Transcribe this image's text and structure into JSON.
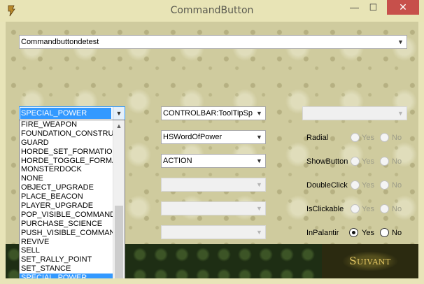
{
  "window": {
    "title": "CommandButton",
    "minimize": "—",
    "maximize": "☐",
    "close": "✕"
  },
  "top_combo": {
    "value": "Commandbuttondetest"
  },
  "command_type": {
    "value": "SPECIAL_POWER",
    "options": [
      "FIRE_WEAPON",
      "FOUNDATION_CONSTRU",
      "GUARD",
      "HORDE_SET_FORMATIO",
      "HORDE_TOGGLE_FORMA",
      "MONSTERDOCK",
      "NONE",
      "OBJECT_UPGRADE",
      "PLACE_BEACON",
      "PLAYER_UPGRADE",
      "POP_VISIBLE_COMMAND",
      "PURCHASE_SCIENCE",
      "PUSH_VISIBLE_COMMAN",
      "REVIVE",
      "SELL",
      "SET_RALLY_POINT",
      "SET_STANCE",
      "SPECIAL_POWER"
    ],
    "selected_index": 17
  },
  "middle_combos": [
    {
      "value": "CONTROLBAR:ToolTipSpe",
      "enabled": true
    },
    {
      "value": "HSWordOfPower",
      "enabled": true
    },
    {
      "value": "ACTION",
      "enabled": true
    },
    {
      "value": "",
      "enabled": false
    },
    {
      "value": "",
      "enabled": false
    },
    {
      "value": "",
      "enabled": false
    }
  ],
  "right_combo": {
    "value": "",
    "enabled": false
  },
  "options": [
    {
      "label": "Radial",
      "yes": "Yes",
      "no": "No",
      "selected": null,
      "enabled": false
    },
    {
      "label": "ShowButton",
      "yes": "Yes",
      "no": "No",
      "selected": null,
      "enabled": false
    },
    {
      "label": "DoubleClick",
      "yes": "Yes",
      "no": "No",
      "selected": null,
      "enabled": false
    },
    {
      "label": "IsClickable",
      "yes": "Yes",
      "no": "No",
      "selected": null,
      "enabled": false
    },
    {
      "label": "InPalantir",
      "yes": "Yes",
      "no": "No",
      "selected": "yes",
      "enabled": true
    }
  ],
  "next_button": {
    "label": "Suivant"
  },
  "icons": {
    "dropdown": "chevron-down-icon",
    "scroll_up": "chevron-up-icon",
    "app": "app-icon"
  },
  "colors": {
    "selection": "#3399ff",
    "close_button": "#c7504b",
    "background": "#cfcb9e"
  }
}
